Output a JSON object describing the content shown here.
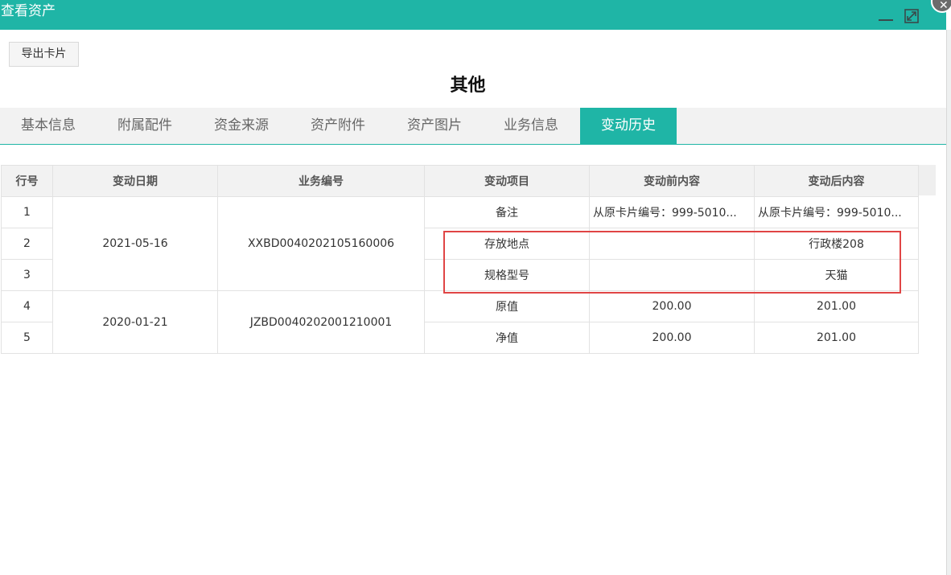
{
  "window": {
    "title": "查看资产",
    "minimize_icon": "minimize-icon",
    "maximize_icon": "maximize-icon",
    "close_icon": "close-icon",
    "close_glyph": "✕",
    "accent_color": "#1fb5a6",
    "highlight_color": "#e04545"
  },
  "toolbar": {
    "export_label": "导出卡片"
  },
  "section_title": "其他",
  "tabs": [
    {
      "label": "基本信息",
      "active": false
    },
    {
      "label": "附属配件",
      "active": false
    },
    {
      "label": "资金来源",
      "active": false
    },
    {
      "label": "资产附件",
      "active": false
    },
    {
      "label": "资产图片",
      "active": false
    },
    {
      "label": "业务信息",
      "active": false
    },
    {
      "label": "变动历史",
      "active": true
    }
  ],
  "table": {
    "headers": [
      "行号",
      "变动日期",
      "业务编号",
      "变动项目",
      "变动前内容",
      "变动后内容"
    ],
    "groups": [
      {
        "date": "2021-05-16",
        "business_no": "XXBD0040202105160006"
      },
      {
        "date": "2020-01-21",
        "business_no": "JZBD0040202001210001"
      }
    ],
    "rows": [
      {
        "no": "1",
        "item": "备注",
        "before": "从原卡片编号：999-5010...",
        "after": "从原卡片编号：999-5010..."
      },
      {
        "no": "2",
        "item": "存放地点",
        "before": "",
        "after": "行政楼208"
      },
      {
        "no": "3",
        "item": "规格型号",
        "before": "",
        "after": "天猫"
      },
      {
        "no": "4",
        "item": "原值",
        "before": "200.00",
        "after": "201.00"
      },
      {
        "no": "5",
        "item": "净值",
        "before": "200.00",
        "after": "201.00"
      }
    ]
  }
}
